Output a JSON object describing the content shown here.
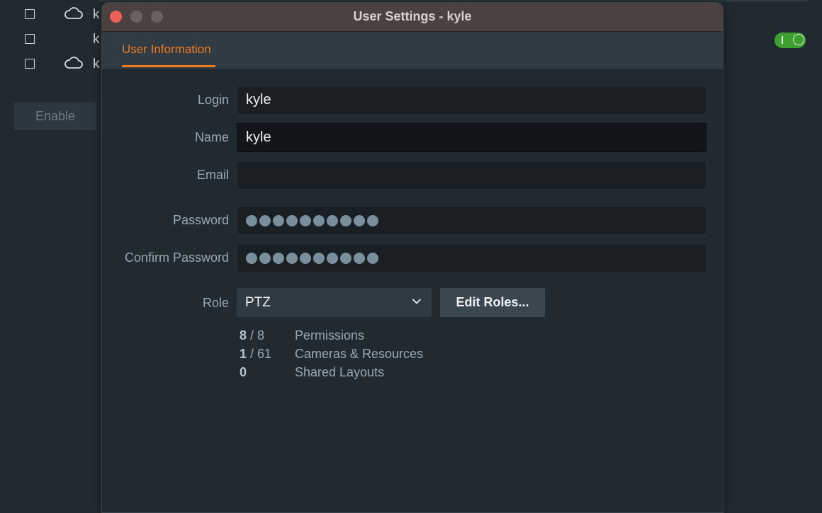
{
  "background": {
    "rows": [
      {
        "letter": "k",
        "has_cloud": true
      },
      {
        "letter": "k",
        "has_cloud": false
      },
      {
        "letter": "k",
        "has_cloud": true
      }
    ],
    "enable_label": "Enable",
    "toggle_on": true
  },
  "dialog": {
    "title": "User Settings - kyle",
    "tabs": [
      {
        "label": "User Information",
        "active": true
      }
    ],
    "fields": {
      "login": {
        "label": "Login",
        "value": "kyle"
      },
      "name": {
        "label": "Name",
        "value": "kyle"
      },
      "email": {
        "label": "Email",
        "value": ""
      },
      "password": {
        "label": "Password",
        "masked_length": 10
      },
      "confirm_password": {
        "label": "Confirm Password",
        "masked_length": 10
      }
    },
    "role": {
      "label": "Role",
      "value": "PTZ",
      "edit_label": "Edit Roles..."
    },
    "stats": [
      {
        "count": "8",
        "total": "/ 8",
        "label": "Permissions"
      },
      {
        "count": "1",
        "total": "/ 61",
        "label": "Cameras & Resources"
      },
      {
        "count": "0",
        "total": "",
        "label": "Shared Layouts"
      }
    ]
  },
  "colors": {
    "accent": "#f07b1f",
    "toggle_on": "#3ea030",
    "close_button": "#ee5f57"
  },
  "icons": [
    "cloud-icon",
    "checkbox-icon",
    "chevron-down-icon",
    "close-icon",
    "minimize-icon",
    "maximize-icon"
  ]
}
